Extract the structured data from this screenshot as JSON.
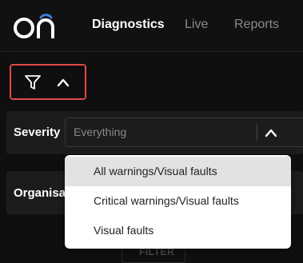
{
  "header": {
    "logo_text": "on",
    "tabs": [
      {
        "label": "Diagnostics",
        "active": true
      },
      {
        "label": "Live",
        "active": false
      },
      {
        "label": "Reports",
        "active": false
      }
    ]
  },
  "filters": {
    "toggle_icons": [
      "funnel-icon",
      "chevron-up-icon"
    ],
    "severity": {
      "label": "Severity",
      "placeholder": "Everything",
      "expanded": true
    },
    "organisation": {
      "label": "Organisat"
    },
    "severity_options": [
      {
        "label": "All warnings/Visual faults",
        "highlighted": true
      },
      {
        "label": "Critical warnings/Visual faults",
        "highlighted": false
      },
      {
        "label": "Visual faults",
        "highlighted": false
      }
    ],
    "filter_button_label": "FILTER"
  },
  "colors": {
    "background": "#0f0f0f",
    "panel": "#1c1c1c",
    "highlight_border": "#e04848",
    "logo_accent": "#3b7dd8"
  }
}
